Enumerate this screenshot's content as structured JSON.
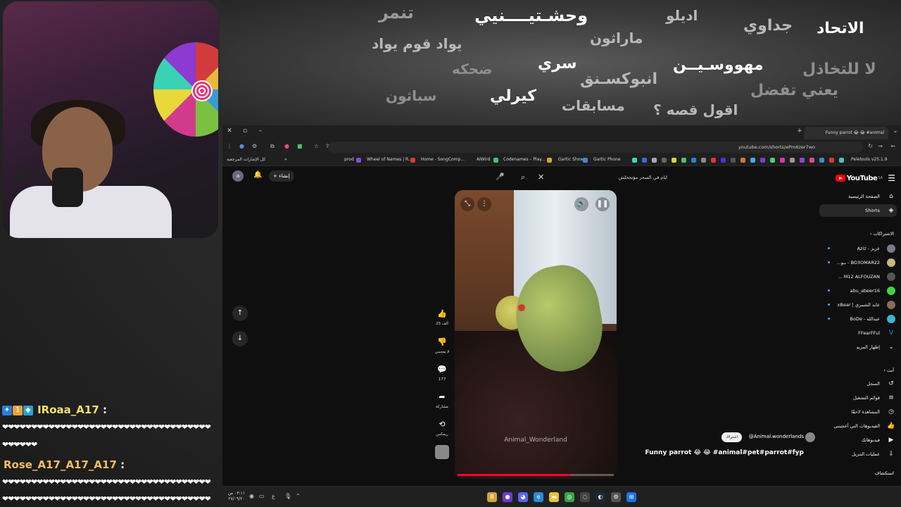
{
  "banner": {
    "words": [
      "تنمر",
      "وحشـتيــــنيي",
      "اديلو",
      "جداوي",
      "الاتحاد",
      "يواد قوم يواد",
      "ماراثون",
      "ضحكه",
      "سري",
      "مهووسـيــن",
      "لا للتخاذل",
      "انبوكسـنق",
      "يعني تفضل",
      "سباثون",
      "كيرلي",
      "مسابقات",
      "اقول قصه ؟"
    ]
  },
  "chat": {
    "messages": [
      {
        "user": "IRoaa_A17",
        "text": "❤❤❤❤❤❤❤❤❤❤❤❤❤❤❤❤❤❤❤❤❤❤❤❤❤❤❤❤❤❤❤❤❤❤❤❤",
        "text2": "❤❤❤❤❤❤"
      },
      {
        "user": "Rose_A17_A17_A17",
        "text": "❤❤❤❤❤❤❤❤❤❤❤❤❤❤❤❤❤❤❤❤❤❤❤❤❤❤❤❤❤❤❤❤❤❤❤❤",
        "text2": "❤❤❤❤❤❤❤❤❤❤❤❤❤❤❤❤❤❤❤❤❤❤❤❤❤❤❤❤❤❤❤❤❤❤❤❤"
      }
    ]
  },
  "browser": {
    "tab_title": "Funny parrot 😂 😂 #animal",
    "url": "youtube.com/shorts/ePm6zer7wo",
    "extension_label": "Peletools v25.1.9",
    "bookmarks": [
      "كل الإشارات المرجعية",
      "prod",
      "Wheel of Names | R...",
      "Home - SongComp...",
      "AlWird",
      "Codenames – Play...",
      "Gartic Show",
      "Gartic Phone"
    ]
  },
  "youtube": {
    "logo": "YouTube",
    "logo_superscript": "SA",
    "search_query": "ايام في السحر مؤتجحلش",
    "create_label": "إنشاء",
    "avatar_letter": "a",
    "sidebar": {
      "home": "الصفحة الرئيسية",
      "shorts": "Shorts",
      "subscriptions_header": "الاشتراكات",
      "subscriptions": [
        "عزيز - Aziz",
        "BO3OMAR22 - بـو...",
        "M12 ALFOUZAN ...",
        "abu_abeer16",
        "عابد الشمري | xBear",
        "عبدالله - BoDe",
        "FFearFFul"
      ],
      "show_more": "إظهار المزيد",
      "you_header": "أنت",
      "you_items": [
        "السجل",
        "قوائم التشغيل",
        "المشاهدة لاحقًا",
        "الفيديوهات التي أعجبتني",
        "فيديوهاتك",
        "عمليات التنزيل"
      ],
      "explore_header": "استكشاف"
    },
    "short": {
      "likes": "25 ألف",
      "dislike_label": "لا يعجبني",
      "comments": "177",
      "share_label": "مشاركة",
      "remix_label": "ريمكس",
      "watermark": "Animal_Wonderland",
      "channel": "@Animal.wonderlands",
      "subscribe": "اشتراك",
      "title": "Funny parrot 😂 😂 #animal#pet#parrot#fyp",
      "progress": 0.72
    }
  },
  "taskbar": {
    "time": "٠٣:١١ ص",
    "date": "٢٧/٠٩/٢٠"
  }
}
